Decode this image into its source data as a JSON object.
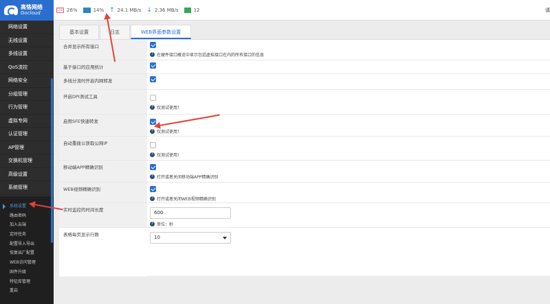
{
  "brand": {
    "name_cn": "高恪网络",
    "name_en": "Gocloud"
  },
  "top_stats": {
    "cpu": "26%",
    "mem": "14%",
    "upload": "24.1 MB/s",
    "download": "2.36 MB/s",
    "clients": "12"
  },
  "top_right_text": "请",
  "sidebar": {
    "items": [
      {
        "label": "网络设置"
      },
      {
        "label": "无线设置"
      },
      {
        "label": "多线设置"
      },
      {
        "label": "QoS流控"
      },
      {
        "label": "网络安全"
      },
      {
        "label": "分组管理"
      },
      {
        "label": "行为管理"
      },
      {
        "label": "虚拟专网"
      },
      {
        "label": "认证管理"
      },
      {
        "label": "AP管理"
      },
      {
        "label": "交换机管理"
      },
      {
        "label": "高级设置"
      },
      {
        "label": "系统管理"
      }
    ],
    "submenu": [
      {
        "label": "系统设置",
        "active": true
      },
      {
        "label": "路由密码"
      },
      {
        "label": "加入云端"
      },
      {
        "label": "定时任务"
      },
      {
        "label": "配置导入导出"
      },
      {
        "label": "恢复出厂配置"
      },
      {
        "label": "WEB访问管理"
      },
      {
        "label": "固件升级"
      },
      {
        "label": "特征库管理"
      },
      {
        "label": "重启"
      }
    ]
  },
  "tabs": [
    {
      "label": "基本设置"
    },
    {
      "label": "日志"
    },
    {
      "label": "WEB界面参数设置",
      "active": true
    }
  ],
  "rows": [
    {
      "label": "合并显示所有接口",
      "checked": true,
      "hint": "在硬件接口概览中显示包括虚拟接口在内的所有接口的信息"
    },
    {
      "label": "基于接口的应用统计",
      "checked": true
    },
    {
      "label": "多线分流时开启内网转发",
      "checked": true
    },
    {
      "label": "开启DPI测试工具",
      "checked": false,
      "hint": "仅测试使用！"
    },
    {
      "label": "启用SFE快速转发",
      "checked": true,
      "hint": "仅测试使用！"
    },
    {
      "label": "自动重拨以获取公网IP",
      "checked": false,
      "hint": "仅测试使用！"
    },
    {
      "label": "移动端APP精确识别",
      "checked": true,
      "hint": "打开或者关闭移动端APP精确识别"
    },
    {
      "label": "WEB视频精确识别",
      "checked": true,
      "hint": "打开或者关闭WEB视频精确识别"
    },
    {
      "label": "实时监控的时间长度",
      "value": "600",
      "hint": "单位：秒"
    },
    {
      "label": "表格每页显示行数",
      "value": "10"
    }
  ],
  "colors": {
    "accent": "#2a6ed0",
    "sidebar_bg": "#2d2d2d",
    "annotation": "#e0413a"
  }
}
